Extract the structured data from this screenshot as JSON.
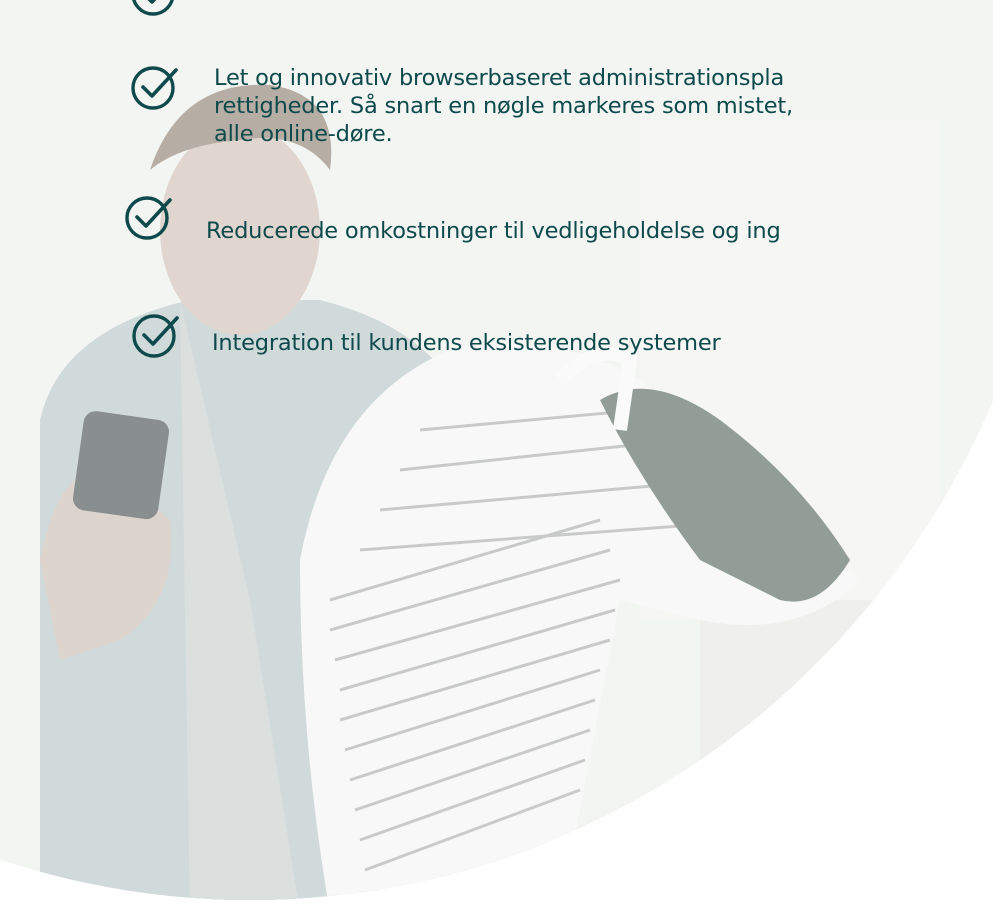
{
  "colors": {
    "text": "#0e4a4c",
    "check": "#0e4a4c",
    "photo_bg": "#eef0ed"
  },
  "icons": [
    "check-circle-icon"
  ],
  "bullets": [
    {
      "lines": [
        "Let og innovativ browserbaseret administrationspla",
        "rettigheder. Så snart en nøgle markeres som mistet,",
        "alle online-døre."
      ]
    },
    {
      "lines": [
        "Reducerede omkostninger til vedligeholdelse og ing"
      ]
    },
    {
      "lines": [
        "Integration til kundens eksisterende systemer"
      ]
    }
  ]
}
